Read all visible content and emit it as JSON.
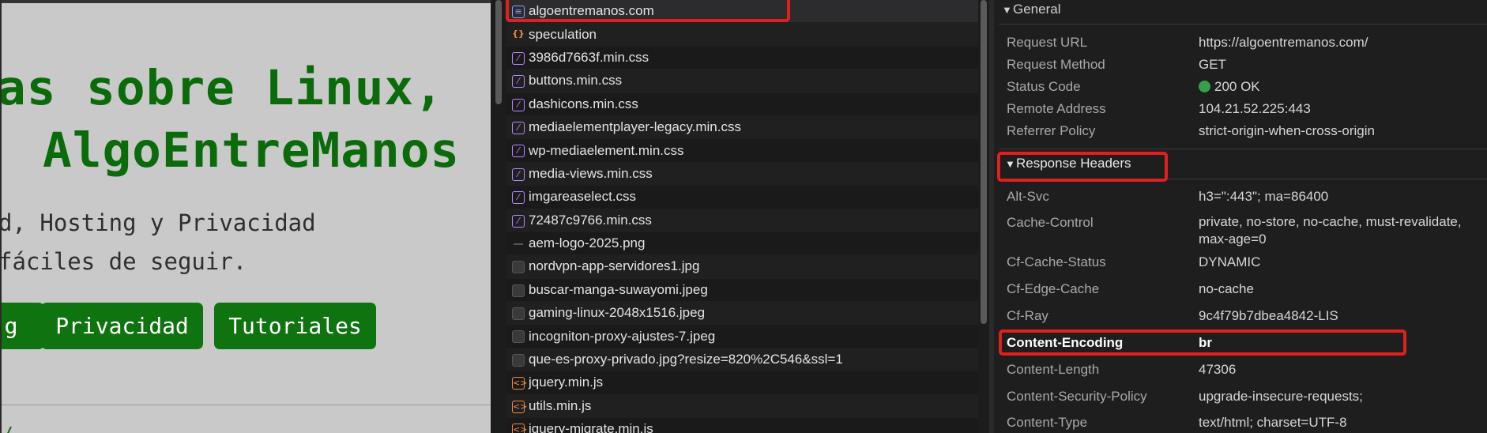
{
  "page_preview": {
    "hero_line1": "as sobre Linux,",
    "hero_line2": "AlgoEntreManos",
    "subtitle_line1": "d, Hosting y Privacidad",
    "subtitle_line2": "fáciles de seguir.",
    "buttons": [
      "g",
      "Privacidad",
      "Tutoriales"
    ],
    "tail_text": "/",
    "colors": {
      "accent": "#0f7410",
      "background": "#c9c9c9"
    }
  },
  "network": {
    "requests": [
      {
        "name": "algoentremanos.com",
        "icon": "document-icon"
      },
      {
        "name": "speculation",
        "icon": "braces-icon"
      },
      {
        "name": "3986d7663f.min.css",
        "icon": "css-icon"
      },
      {
        "name": "buttons.min.css",
        "icon": "css-icon"
      },
      {
        "name": "dashicons.min.css",
        "icon": "css-icon"
      },
      {
        "name": "mediaelementplayer-legacy.min.css",
        "icon": "css-icon"
      },
      {
        "name": "wp-mediaelement.min.css",
        "icon": "css-icon"
      },
      {
        "name": "media-views.min.css",
        "icon": "css-icon"
      },
      {
        "name": "imgareaselect.css",
        "icon": "css-icon"
      },
      {
        "name": "72487c9766.min.css",
        "icon": "css-icon"
      },
      {
        "name": "aem-logo-2025.png",
        "icon": "image-icon"
      },
      {
        "name": "nordvpn-app-servidores1.jpg",
        "icon": "image-icon"
      },
      {
        "name": "buscar-manga-suwayomi.jpeg",
        "icon": "image-icon"
      },
      {
        "name": "gaming-linux-2048x1516.jpeg",
        "icon": "image-icon"
      },
      {
        "name": "incogniton-proxy-ajustes-7.jpeg",
        "icon": "image-icon"
      },
      {
        "name": "que-es-proxy-privado.jpg?resize=820%2C546&ssl=1",
        "icon": "image-icon"
      },
      {
        "name": "jquery.min.js",
        "icon": "script-icon"
      },
      {
        "name": "utils.min.js",
        "icon": "script-icon"
      },
      {
        "name": "jquery-migrate.min.js",
        "icon": "script-icon"
      }
    ]
  },
  "headers": {
    "general_title": "General",
    "general": [
      {
        "key": "Request URL",
        "value": "https://algoentremanos.com/"
      },
      {
        "key": "Request Method",
        "value": "GET"
      },
      {
        "key": "Status Code",
        "value": "200 OK"
      },
      {
        "key": "Remote Address",
        "value": "104.21.52.225:443"
      },
      {
        "key": "Referrer Policy",
        "value": "strict-origin-when-cross-origin"
      }
    ],
    "response_title": "Response Headers",
    "response": [
      {
        "key": "Alt-Svc",
        "value": "h3=\":443\"; ma=86400"
      },
      {
        "key": "Cache-Control",
        "value": "private, no-store, no-cache, must-revalidate, max-age=0"
      },
      {
        "key": "Cf-Cache-Status",
        "value": "DYNAMIC"
      },
      {
        "key": "Cf-Edge-Cache",
        "value": "no-cache"
      },
      {
        "key": "Cf-Ray",
        "value": "9c4f79b7dbea4842-LIS"
      },
      {
        "key": "Content-Encoding",
        "value": "br"
      },
      {
        "key": "Content-Length",
        "value": "47306"
      },
      {
        "key": "Content-Security-Policy",
        "value": "upgrade-insecure-requests;"
      },
      {
        "key": "Content-Type",
        "value": "text/html; charset=UTF-8"
      }
    ],
    "status_color": "#35a04a",
    "highlight_color": "#e0201f"
  }
}
